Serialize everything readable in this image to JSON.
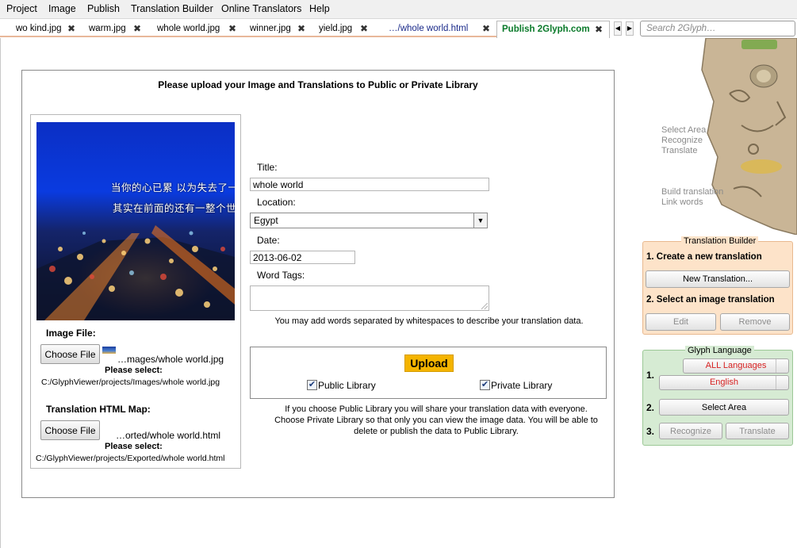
{
  "menu": [
    "Project",
    "Image",
    "Publish",
    "Translation Builder",
    "Online Translators",
    "Help"
  ],
  "tabs": [
    {
      "label": "wo kind.jpg"
    },
    {
      "label": "warm.jpg"
    },
    {
      "label": "whole world.jpg"
    },
    {
      "label": "winner.jpg"
    },
    {
      "label": "yield.jpg"
    },
    {
      "label": "…/whole world.html"
    },
    {
      "label": "Publish 2Glyph.com",
      "active": true
    }
  ],
  "search": {
    "placeholder": "Search 2Glyph…"
  },
  "panel": {
    "heading": "Please upload your Image and Translations to Public or Private Library",
    "preview_text_line1": "当你的心已累 以为失去了一切",
    "preview_text_line2": "其实在前面的还有一整个世界",
    "image_file_label": "Image File:",
    "choose_file": "Choose File",
    "image_file_name": "…mages/whole world.jpg",
    "please_select": "Please select:",
    "image_file_path": "C:/GlyphViewer/projects/Images/whole world.jpg",
    "html_map_label": "Translation HTML Map:",
    "html_file_name": "…orted/whole world.html",
    "html_file_path": "C:/GlyphViewer/projects/Exported/whole world.html"
  },
  "form": {
    "title_label": "Title:",
    "title_value": "whole world",
    "location_label": "Location:",
    "location_value": "Egypt",
    "date_label": "Date:",
    "date_value": "2013-06-02",
    "tags_label": "Word Tags:",
    "tags_value": "",
    "tags_hint": "You may add words separated by whitespaces to describe your translation data.",
    "upload_label": "Upload",
    "public_label": "Public Library",
    "public_checked": true,
    "private_label": "Private Library",
    "private_checked": true,
    "note_line1": "If you choose Public Library you will share your translation data with everyone.",
    "note_line2": "Choose Private Library so that only you can view the image data. You will be able to",
    "note_line3": "delete or publish the data to Public Library."
  },
  "sidebar": {
    "links": [
      "Select Area",
      "Recognize",
      "Translate",
      "Build translation",
      "Link words"
    ],
    "translation_builder": {
      "title": "Translation Builder",
      "step1": "1. Create a new translation",
      "new_translation": "New Translation...",
      "step2": "2. Select an image translation",
      "edit": "Edit",
      "remove": "Remove"
    },
    "glyph_language": {
      "title": "Glyph Language",
      "step1": "1.",
      "all_languages": "ALL Languages",
      "english": "English",
      "step2": "2.",
      "select_area": "Select Area",
      "step3": "3.",
      "recognize": "Recognize",
      "translate": "Translate"
    }
  },
  "colors": {
    "active_tab_text": "#0a7a2a",
    "upload_button": "#f4b400",
    "translation_builder_bg": "#fde3c9",
    "glyph_language_bg": "#d6ebd3",
    "language_text": "#d61f1f"
  }
}
